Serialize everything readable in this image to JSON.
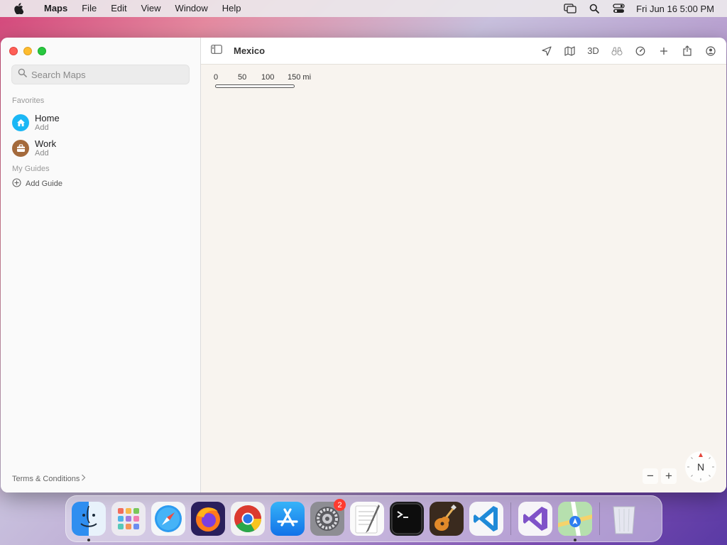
{
  "menubar": {
    "app_name": "Maps",
    "items": [
      "File",
      "Edit",
      "View",
      "Window",
      "Help"
    ],
    "clock": "Fri Jun 16  5:00 PM"
  },
  "sidebar": {
    "search_placeholder": "Search Maps",
    "favorites_label": "Favorites",
    "favorites": [
      {
        "name": "Home",
        "sub": "Add",
        "color": "#1bb7f5",
        "icon": "house-icon"
      },
      {
        "name": "Work",
        "sub": "Add",
        "color": "#a46a3c",
        "icon": "briefcase-icon"
      }
    ],
    "guides_label": "My Guides",
    "add_guide": "Add Guide",
    "terms": "Terms & Conditions"
  },
  "toolbar": {
    "title": "Mexico",
    "three_d": "3D"
  },
  "map": {
    "scale_labels": [
      "0",
      "50",
      "100",
      "150 mi"
    ],
    "compass": "N",
    "zoom_out": "−",
    "zoom_in": "+"
  },
  "dock": {
    "settings_badge": "2"
  }
}
